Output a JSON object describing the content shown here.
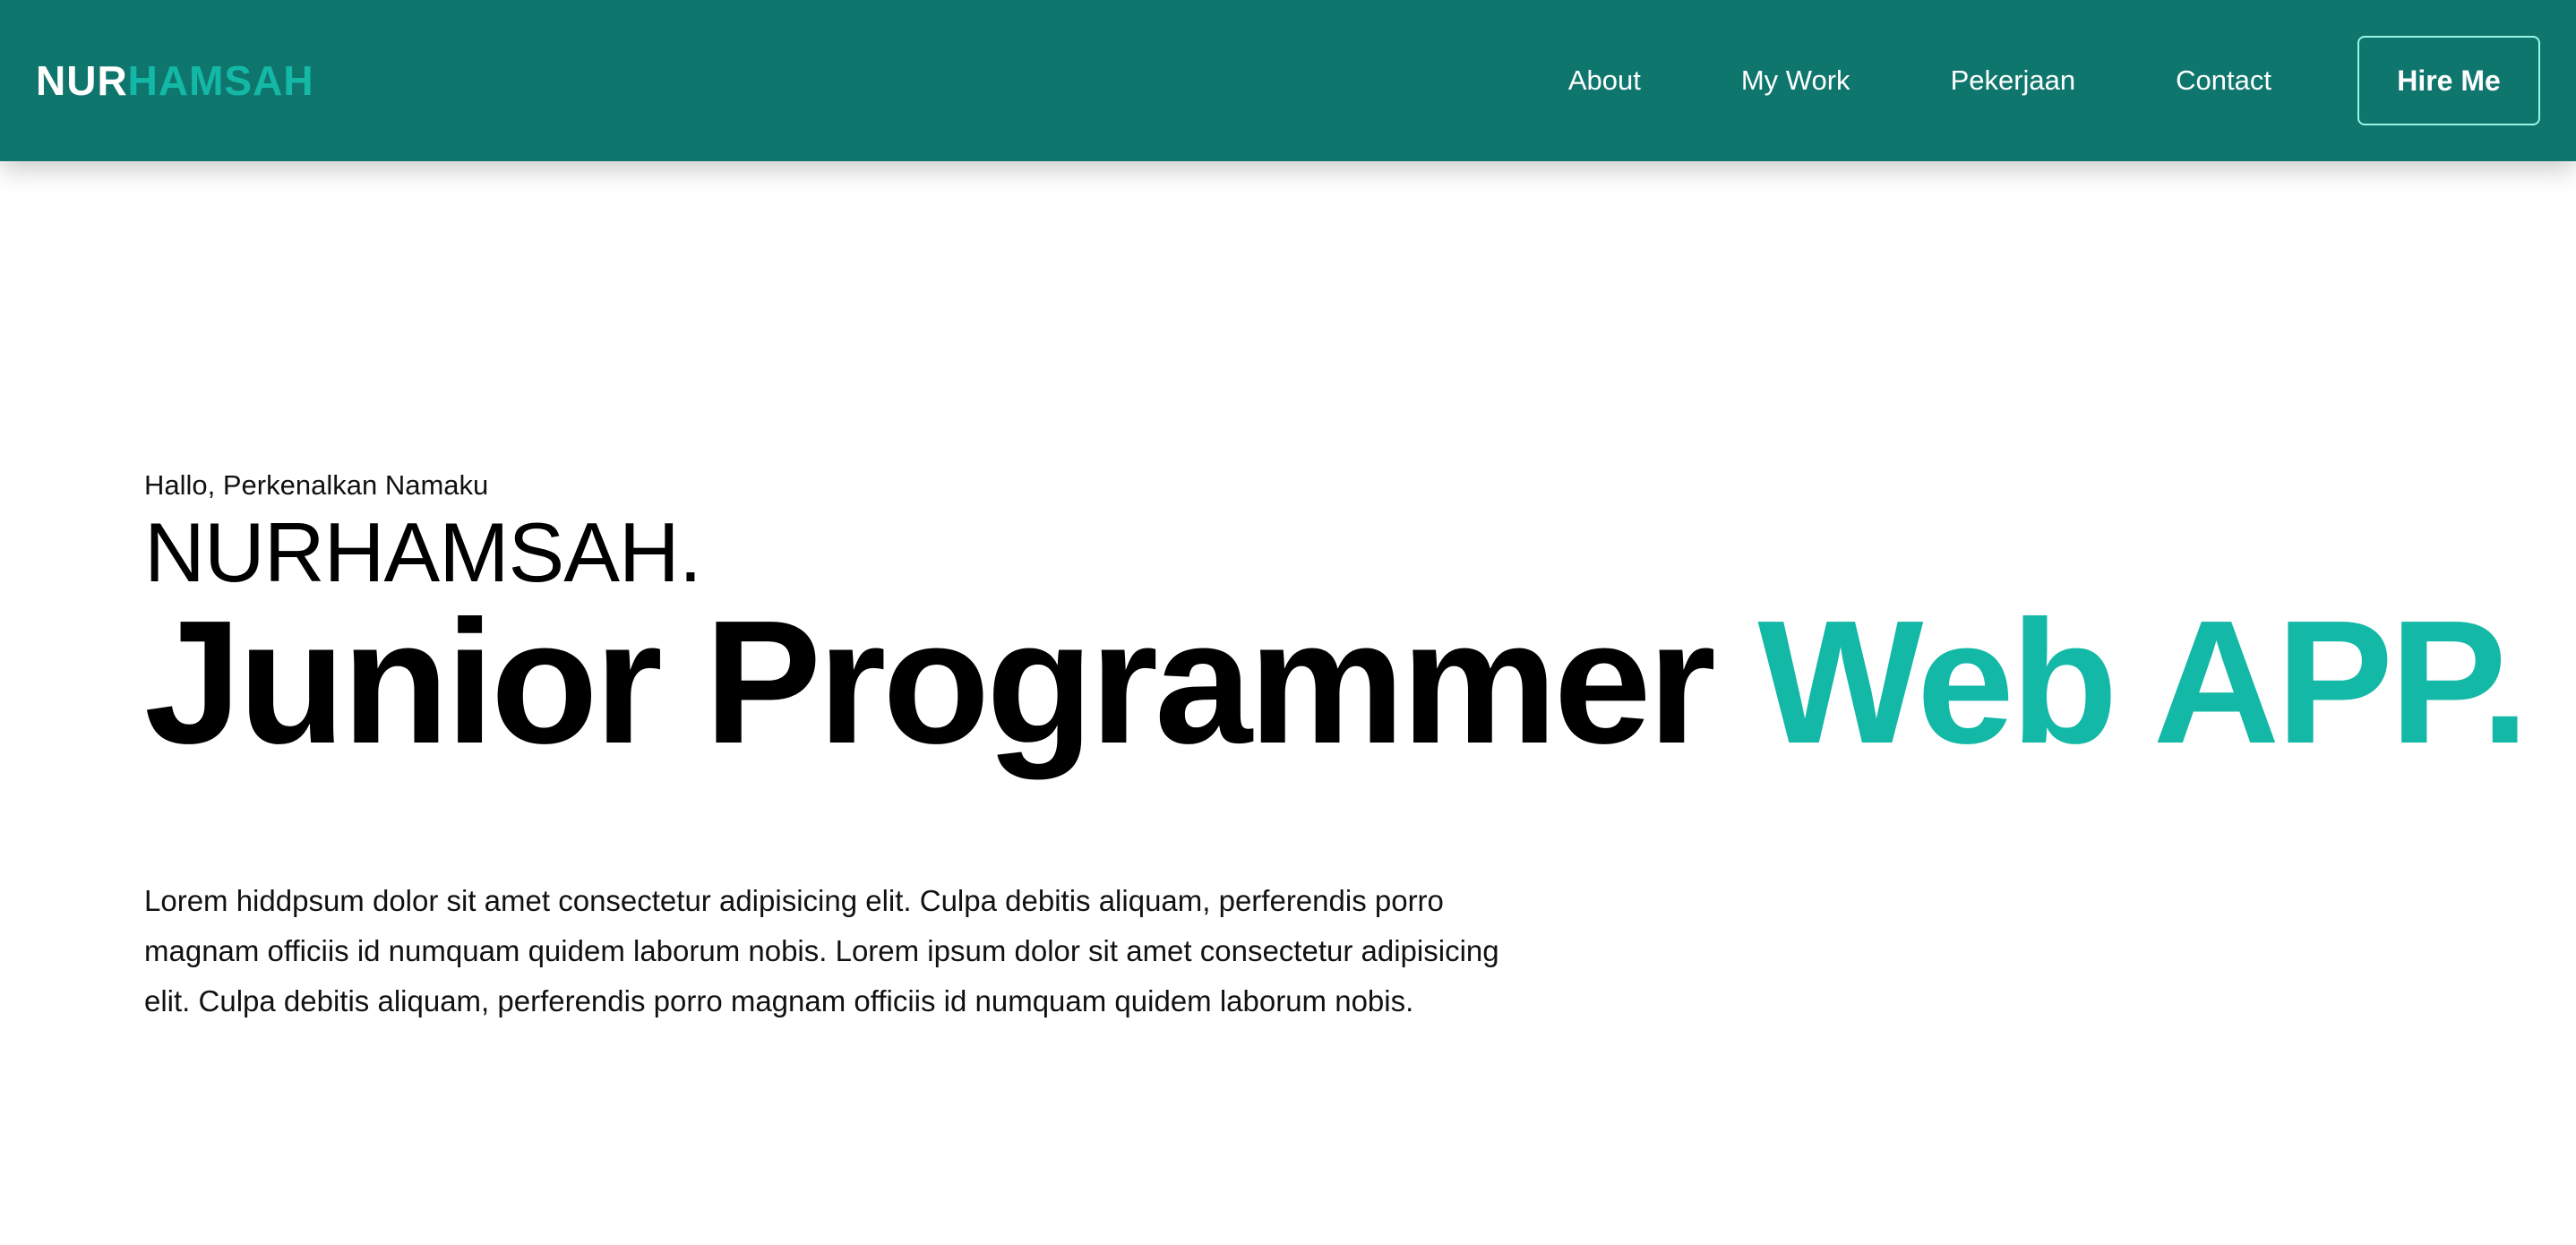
{
  "header": {
    "logo_part1": "NUR",
    "logo_part2": "HAMSAH",
    "nav": {
      "about": "About",
      "my_work": "My Work",
      "pekerjaan": "Pekerjaan",
      "contact": "Contact"
    },
    "cta": "Hire Me"
  },
  "hero": {
    "greeting": "Hallo, Perkenalkan Namaku",
    "name": "NURHAMSAH.",
    "headline_dark": "Junior Programmer",
    "headline_accent": "Web APP.",
    "description": "Lorem hiddpsum dolor sit amet consectetur adipisicing elit. Culpa debitis aliquam, perferendis porro magnam officiis id numquam quidem laborum nobis. Lorem ipsum dolor sit amet consectetur adipisicing elit. Culpa debitis aliquam, perferendis porro magnam officiis id numquam quidem laborum nobis."
  },
  "colors": {
    "header_bg": "#0f766e",
    "accent": "#14b8a6",
    "button_border": "#99f6e4"
  }
}
